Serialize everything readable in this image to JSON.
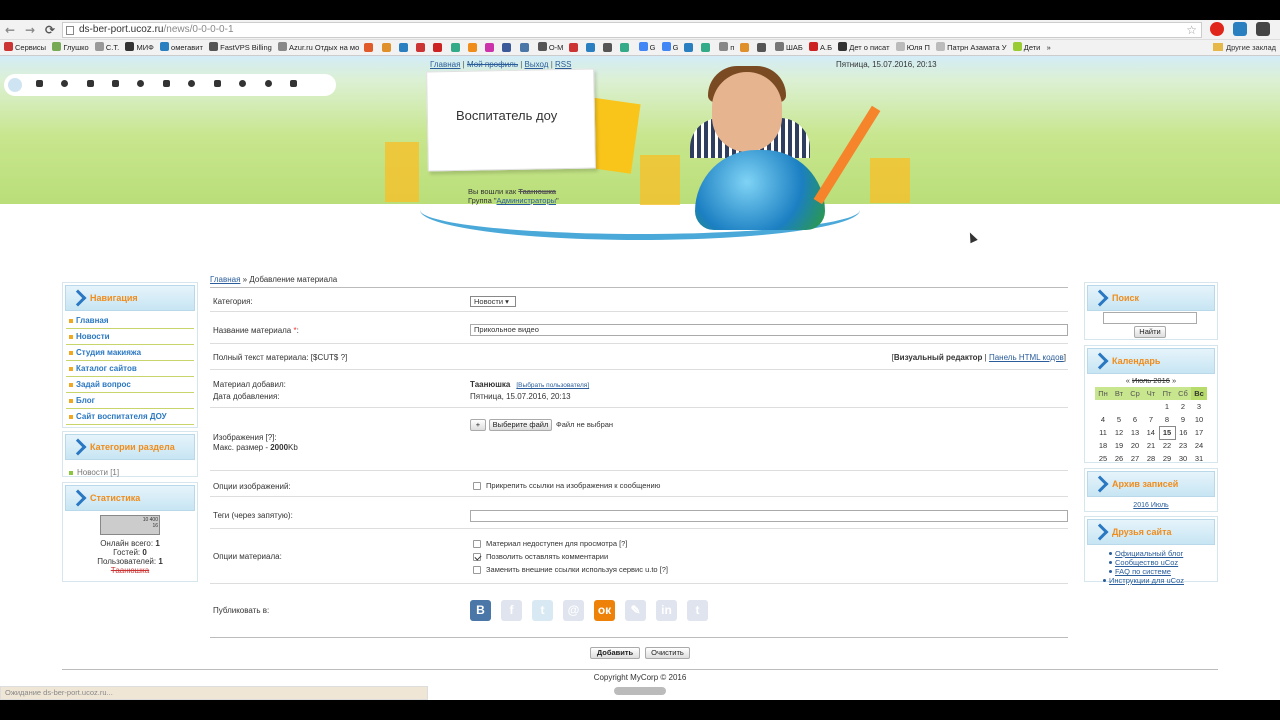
{
  "browser": {
    "url_host": "ds-ber-port.ucoz.ru",
    "url_path": "/news/0-0-0-0-1",
    "status_text": "Ожидание ds-ber-port.ucoz.ru..."
  },
  "bookmarks": {
    "items": [
      "Сервисы",
      "Глушко",
      "С.Т.",
      "МИФ",
      "омегавит",
      "FastVPS Billing",
      "Azur.ru Отдых на мо",
      "О-М",
      "G",
      "G",
      "п",
      "ШАБ",
      "А.Б",
      "Дет о писат",
      "Юля П",
      "Патрн Азамата У",
      "Дети"
    ],
    "more": "»",
    "other": "Другие заклад"
  },
  "header": {
    "links": [
      "Главная",
      "Мой профиль",
      "Выход",
      "RSS"
    ],
    "datetime": "Пятница, 15.07.2016, 20:13",
    "site_title": "Воспитатель доу",
    "login_prefix": "Вы вошли как",
    "login_user": "Таанюшка",
    "group_prefix": "Группа \"",
    "group_name": "Администраторы",
    "group_suffix": "\""
  },
  "left": {
    "nav_title": "Навигация",
    "nav_items": [
      "Главная",
      "Новости",
      "Студия макияжа",
      "Каталог сайтов",
      "Задай вопрос",
      "Блог",
      "Сайт воспитателя ДОУ"
    ],
    "cat_title": "Категории раздела",
    "cat_item": "Новости",
    "cat_count": "[1]",
    "stats_title": "Статистика",
    "counter_lines": [
      "10 400",
      "16"
    ],
    "online_total_label": "Онлайн всего:",
    "online_total": "1",
    "guests_label": "Гостей:",
    "guests": "0",
    "users_label": "Пользователей:",
    "users": "1",
    "online_user": "Таанюшка"
  },
  "main": {
    "crumb_home": "Главная",
    "crumb_sep": " » ",
    "crumb_current": "Добавление материала",
    "category_label": "Категория:",
    "category_value": "Новости",
    "title_label": "Название материала ",
    "required_mark": "*",
    "title_colon": ":",
    "title_value": "Прикольное видео",
    "fulltext_label": "Полный текст материала: [$CUT$ ?]",
    "visual_editor": "Визуальный редактор",
    "html_panel": "Панель HTML кодов",
    "added_by_label": "Материал добавил:",
    "added_by": "Таанюшка",
    "choose_user": "[Выбрать пользователя]",
    "date_label": "Дата добавления:",
    "date_value": "Пятница, 15.07.2016, 20:13",
    "images_label": "Изображения [?]:",
    "max_size_prefix": "Макс. размер - ",
    "max_size": "2000",
    "max_size_unit": "Kb",
    "plus": "+",
    "choose_file": "Выберите файл",
    "no_file": "Файл не выбран",
    "image_opts_label": "Опции изображений:",
    "attach_links": "Прикрепить ссылки на изображения к сообщению",
    "tags_label": "Теги (через запятую):",
    "tags_value": "",
    "material_opts_label": "Опции материала:",
    "opt1": "Материал недоступен для просмотра [?]",
    "opt2": "Позволить оставлять комментарии",
    "opt3": "Заменить внешние ссылки используя сервис u.to [?]",
    "publish_label": "Публиковать в:",
    "share_icons": [
      "vkontakte-icon",
      "facebook-icon",
      "twitter-icon",
      "mail-ru-icon",
      "odnoklassniki-icon",
      "livejournal-icon",
      "linkedin-icon",
      "tumblr-icon"
    ],
    "add_button": "Добавить",
    "clear_button": "Очистить"
  },
  "right": {
    "search_title": "Поиск",
    "search_button": "Найти",
    "calendar_title": "Календарь",
    "cal_month": "Июль 2016",
    "cal_prev": "«",
    "cal_next": "»",
    "cal_days": [
      "Пн",
      "Вт",
      "Ср",
      "Чт",
      "Пт",
      "Сб",
      "Вс"
    ],
    "cal_rows": [
      [
        "",
        "",
        "",
        "",
        "1",
        "2",
        "3"
      ],
      [
        "4",
        "5",
        "6",
        "7",
        "8",
        "9",
        "10"
      ],
      [
        "11",
        "12",
        "13",
        "14",
        "15",
        "16",
        "17"
      ],
      [
        "18",
        "19",
        "20",
        "21",
        "22",
        "23",
        "24"
      ],
      [
        "25",
        "26",
        "27",
        "28",
        "29",
        "30",
        "31"
      ]
    ],
    "archive_title": "Архив записей",
    "archive_link": "2016 Июль",
    "friends_title": "Друзья сайта",
    "friends": [
      "Официальный блог",
      "Сообщество uCoz",
      "FAQ по системе",
      "Инструкции для uCoz"
    ]
  },
  "footer": {
    "copyright": "Copyright MyCorp © 2016"
  },
  "colors": {
    "accent_orange": "#f08c1a",
    "link_blue": "#2a5d9a",
    "header_green": "#b9de78"
  }
}
